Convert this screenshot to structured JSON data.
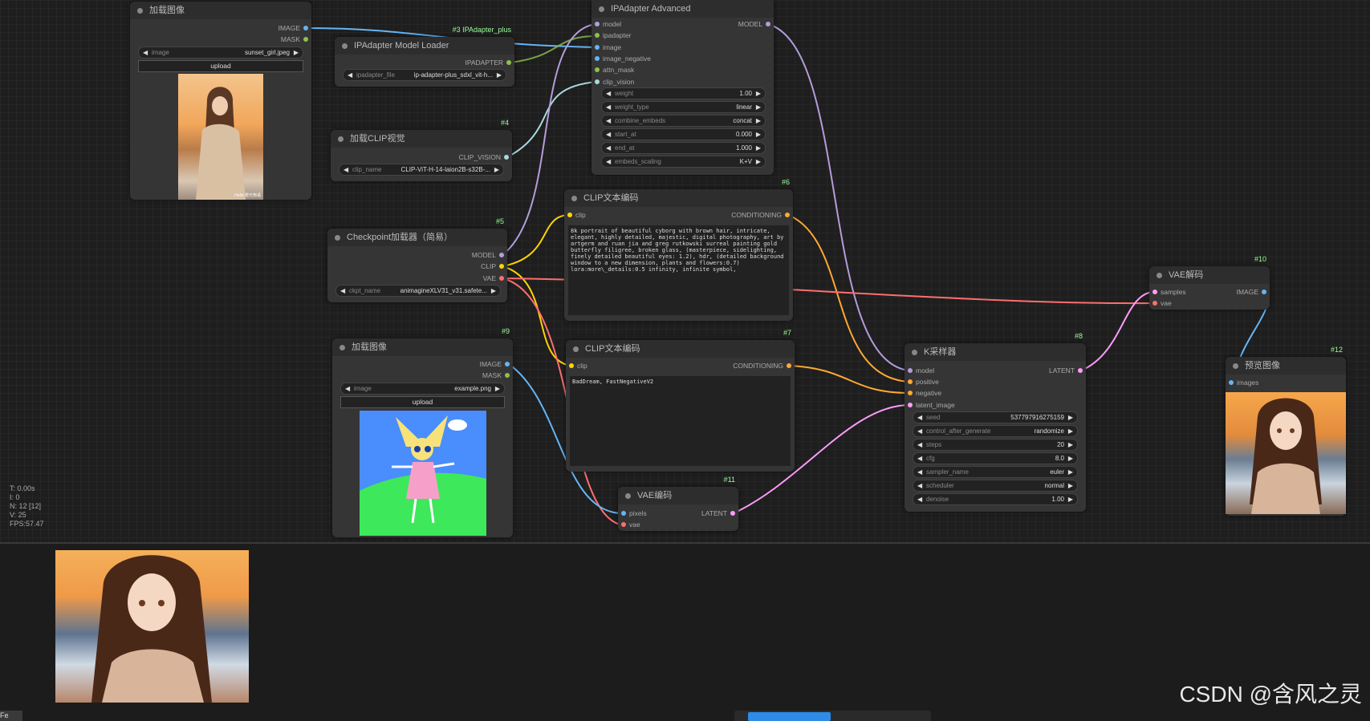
{
  "nodes": {
    "load_image_1": {
      "title": "加载图像",
      "out_image": "IMAGE",
      "out_mask": "MASK",
      "widget_label": "image",
      "widget_value": "sunset_girl.jpeg",
      "upload": "upload",
      "caption": "Hello 橙光物语"
    },
    "ipadapter_loader": {
      "id": "#3 IPAdapter_plus",
      "title": "IPAdapter Model Loader",
      "out": "IPADAPTER",
      "widget_label": "ipadapter_file",
      "widget_value": "ip-adapter-plus_sdxl_vit-h..."
    },
    "clip_vision": {
      "id": "#4",
      "title": "加载CLIP视觉",
      "out": "CLIP_VISION",
      "widget_label": "clip_name",
      "widget_value": "CLIP-ViT-H-14-laion2B-s32B-..."
    },
    "ipadapter_adv": {
      "title": "IPAdapter Advanced",
      "out": "MODEL",
      "inputs": [
        "model",
        "ipadapter",
        "image",
        "image_negative",
        "attn_mask",
        "clip_vision"
      ],
      "widgets": [
        {
          "label": "weight",
          "value": "1.00"
        },
        {
          "label": "weight_type",
          "value": "linear"
        },
        {
          "label": "combine_embeds",
          "value": "concat"
        },
        {
          "label": "start_at",
          "value": "0.000"
        },
        {
          "label": "end_at",
          "value": "1.000"
        },
        {
          "label": "embeds_scaling",
          "value": "K+V"
        }
      ]
    },
    "checkpoint": {
      "id": "#5",
      "title": "Checkpoint加载器（简易）",
      "out_model": "MODEL",
      "out_clip": "CLIP",
      "out_vae": "VAE",
      "widget_label": "ckpt_name",
      "widget_value": "animagineXLV31_v31.safete..."
    },
    "clip_pos": {
      "id": "#6",
      "title": "CLIP文本编码",
      "in": "clip",
      "out": "CONDITIONING",
      "text": "8k portrait of beautiful cyborg with brown hair, intricate, elegant, highly detailed, majestic, digital photography, art by artgerm and ruan jia and greg rutkowski surreal painting gold butterfly filigree, broken glass, (masterpiece, sidelighting, finely detailed beautiful eyes: 1.2), hdr, (detailed background window to a new dimension, plants and flowers:0.7) lora:more\\_details:0.5 infinity, infinite symbol,"
    },
    "clip_neg": {
      "id": "#7",
      "title": "CLIP文本编码",
      "in": "clip",
      "out": "CONDITIONING",
      "text": "BadDream, FastNegativeV2"
    },
    "load_image_2": {
      "id": "#9",
      "title": "加载图像",
      "out_image": "IMAGE",
      "out_mask": "MASK",
      "widget_label": "image",
      "widget_value": "example.png",
      "upload": "upload"
    },
    "vae_encode": {
      "id": "#11",
      "title": "VAE编码",
      "in_pixels": "pixels",
      "in_vae": "vae",
      "out": "LATENT"
    },
    "ksampler": {
      "id": "#8",
      "title": "K采样器",
      "out": "LATENT",
      "inputs": [
        "model",
        "positive",
        "negative",
        "latent_image"
      ],
      "widgets": [
        {
          "label": "seed",
          "value": "537797916275159"
        },
        {
          "label": "control_after_generate",
          "value": "randomize"
        },
        {
          "label": "steps",
          "value": "20"
        },
        {
          "label": "cfg",
          "value": "8.0"
        },
        {
          "label": "sampler_name",
          "value": "euler"
        },
        {
          "label": "scheduler",
          "value": "normal"
        },
        {
          "label": "denoise",
          "value": "1.00"
        }
      ]
    },
    "vae_decode": {
      "id": "#10",
      "title": "VAE解码",
      "in_samples": "samples",
      "in_vae": "vae",
      "out": "IMAGE"
    },
    "preview": {
      "id": "#12",
      "title": "预览图像",
      "in": "images"
    }
  },
  "stats": [
    "T: 0.00s",
    "I: 0",
    "N: 12 [12]",
    "V: 25",
    "FPS:57.47"
  ],
  "watermark": "CSDN @含风之灵",
  "bottom_left": "Fe",
  "colors": {
    "model": "#b39ddb",
    "clip": "#ffd500",
    "vae": "#ff6e6e",
    "image": "#64b5f6",
    "latent": "#ff9cf9",
    "conditioning": "#ffa931",
    "clip_vision": "#a8dadc",
    "ipadapter": "#8bc34a"
  }
}
